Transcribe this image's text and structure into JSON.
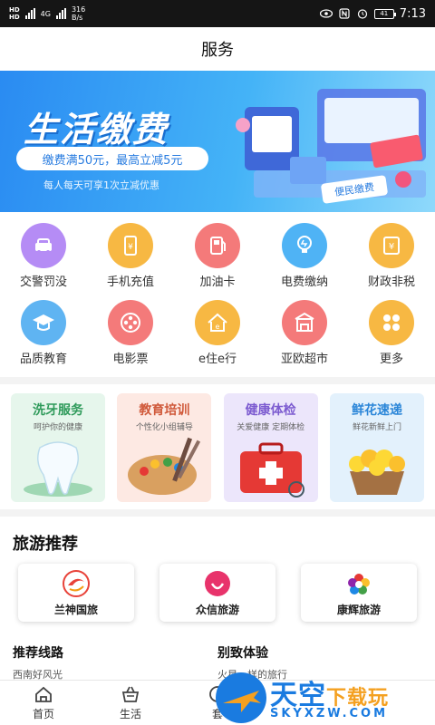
{
  "status_bar": {
    "network_label": "HD",
    "signal_label": "4G",
    "speed_value": "316",
    "speed_unit": "B/s",
    "battery_level": "41",
    "time": "7:13"
  },
  "header": {
    "title": "服务"
  },
  "banner": {
    "title": "生活缴费",
    "promo": "缴费满50元，最高立减5元",
    "subtitle": "每人每天可享1次立减优惠",
    "tag": "便民缴费"
  },
  "services": [
    {
      "label": "交警罚没",
      "icon": "car-icon",
      "color": "#b58cf5"
    },
    {
      "label": "手机充值",
      "icon": "phone-icon",
      "color": "#f7b843"
    },
    {
      "label": "加油卡",
      "icon": "fuel-card-icon",
      "color": "#f47a7a"
    },
    {
      "label": "电费缴纳",
      "icon": "bulb-icon",
      "color": "#4fb3f5"
    },
    {
      "label": "财政非税",
      "icon": "money-icon",
      "color": "#f7b843"
    },
    {
      "label": "品质教育",
      "icon": "graduation-cap-icon",
      "color": "#5fb4f2"
    },
    {
      "label": "电影票",
      "icon": "film-reel-icon",
      "color": "#f47a7a"
    },
    {
      "label": "e住e行",
      "icon": "house-icon",
      "color": "#f7b843"
    },
    {
      "label": "亚欧超市",
      "icon": "shop-icon",
      "color": "#f47a7a"
    },
    {
      "label": "更多",
      "icon": "more-icon",
      "color": "#f7b843"
    }
  ],
  "cards": [
    {
      "title": "洗牙服务",
      "subtitle": "呵护你的健康",
      "bg": "#e6f6ec",
      "title_color": "#2e9a5a",
      "icon": "tooth-icon"
    },
    {
      "title": "教育培训",
      "subtitle": "个性化小组辅导",
      "bg": "#fde9e3",
      "title_color": "#d0593a",
      "icon": "palette-icon"
    },
    {
      "title": "健康体检",
      "subtitle": "关爱健康 定期体检",
      "bg": "#ece6fb",
      "title_color": "#7c5bd0",
      "icon": "medical-kit-icon"
    },
    {
      "title": "鲜花速递",
      "subtitle": "鲜花新鲜上门",
      "bg": "#e3f1fc",
      "title_color": "#2b86d8",
      "icon": "flower-basket-icon"
    }
  ],
  "travel": {
    "title": "旅游推荐",
    "agencies": [
      {
        "name": "兰神国旅",
        "icon": "lanshen-logo",
        "color": "#e8433a"
      },
      {
        "name": "众信旅游",
        "icon": "zhongxin-logo",
        "color": "#e8336b"
      },
      {
        "name": "康辉旅游",
        "icon": "kanghui-logo",
        "color": "#4caf50"
      }
    ]
  },
  "routes": [
    {
      "title": "推荐线路",
      "subtitle": "西南好风光"
    },
    {
      "title": "别致体验",
      "subtitle": "火星一样的旅行"
    }
  ],
  "tabbar": [
    {
      "label": "首页",
      "icon": "home-icon"
    },
    {
      "label": "生活",
      "icon": "basket-icon"
    },
    {
      "label": "套",
      "icon": "tab-icon"
    }
  ],
  "watermark": {
    "title": "天空",
    "title_accent": "下载玩",
    "url": "SKYXZW.COM"
  }
}
